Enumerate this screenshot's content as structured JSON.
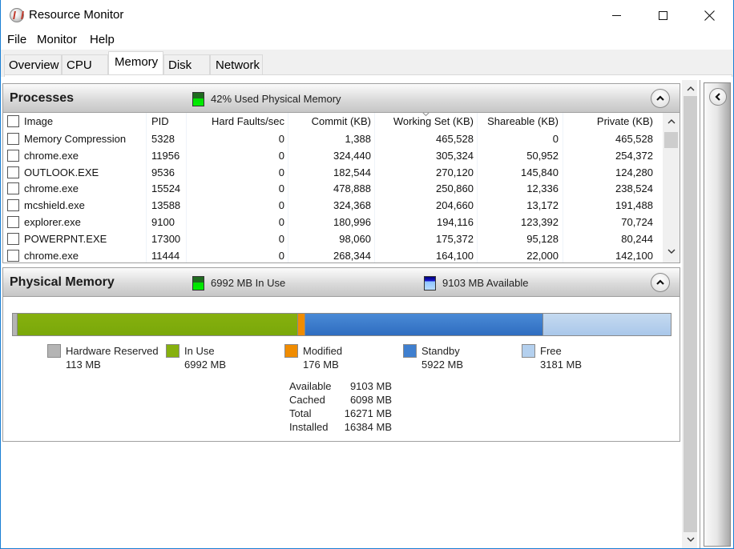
{
  "window": {
    "title": "Resource Monitor",
    "controls": {
      "minimize": "minimize",
      "maximize": "maximize",
      "close": "close"
    }
  },
  "menu": [
    "File",
    "Monitor",
    "Help"
  ],
  "tabs": [
    {
      "label": "Overview",
      "active": false
    },
    {
      "label": "CPU",
      "active": false
    },
    {
      "label": "Memory",
      "active": true
    },
    {
      "label": "Disk",
      "active": false
    },
    {
      "label": "Network",
      "active": false
    }
  ],
  "processes": {
    "title": "Processes",
    "meter_text": "42% Used Physical Memory",
    "columns": [
      "Image",
      "PID",
      "Hard Faults/sec",
      "Commit (KB)",
      "Working Set (KB)",
      "Shareable (KB)",
      "Private (KB)"
    ],
    "sorted_column": "Working Set (KB)",
    "rows": [
      {
        "image": "Memory Compression",
        "pid": "5328",
        "hard_faults": "0",
        "commit": "1,388",
        "working_set": "465,528",
        "shareable": "0",
        "private": "465,528"
      },
      {
        "image": "chrome.exe",
        "pid": "11956",
        "hard_faults": "0",
        "commit": "324,440",
        "working_set": "305,324",
        "shareable": "50,952",
        "private": "254,372"
      },
      {
        "image": "OUTLOOK.EXE",
        "pid": "9536",
        "hard_faults": "0",
        "commit": "182,544",
        "working_set": "270,120",
        "shareable": "145,840",
        "private": "124,280"
      },
      {
        "image": "chrome.exe",
        "pid": "15524",
        "hard_faults": "0",
        "commit": "478,888",
        "working_set": "250,860",
        "shareable": "12,336",
        "private": "238,524"
      },
      {
        "image": "mcshield.exe",
        "pid": "13588",
        "hard_faults": "0",
        "commit": "324,368",
        "working_set": "204,660",
        "shareable": "13,172",
        "private": "191,488"
      },
      {
        "image": "explorer.exe",
        "pid": "9100",
        "hard_faults": "0",
        "commit": "180,996",
        "working_set": "194,116",
        "shareable": "123,392",
        "private": "70,724"
      },
      {
        "image": "POWERPNT.EXE",
        "pid": "17300",
        "hard_faults": "0",
        "commit": "98,060",
        "working_set": "175,372",
        "shareable": "95,128",
        "private": "80,244"
      },
      {
        "image": "chrome.exe",
        "pid": "11444",
        "hard_faults": "0",
        "commit": "268,344",
        "working_set": "164,100",
        "shareable": "22,000",
        "private": "142,100"
      }
    ]
  },
  "physical_memory": {
    "title": "Physical Memory",
    "in_use_text": "6992 MB In Use",
    "available_text": "9103 MB Available",
    "segments": [
      {
        "label": "Hardware Reserved",
        "value_mb": 113,
        "value_text": "113 MB",
        "color": "#b4b4b4"
      },
      {
        "label": "In Use",
        "value_mb": 6992,
        "value_text": "6992 MB",
        "color": "#86b00e"
      },
      {
        "label": "Modified",
        "value_mb": 176,
        "value_text": "176 MB",
        "color": "#f08c00"
      },
      {
        "label": "Standby",
        "value_mb": 5922,
        "value_text": "5922 MB",
        "color": "#3f7fcf"
      },
      {
        "label": "Free",
        "value_mb": 3181,
        "value_text": "3181 MB",
        "color": "#b4d0ee"
      }
    ],
    "stats": [
      {
        "label": "Available",
        "value": "9103 MB"
      },
      {
        "label": "Cached",
        "value": "6098 MB"
      },
      {
        "label": "Total",
        "value": "16271 MB"
      },
      {
        "label": "Installed",
        "value": "16384 MB"
      }
    ]
  }
}
